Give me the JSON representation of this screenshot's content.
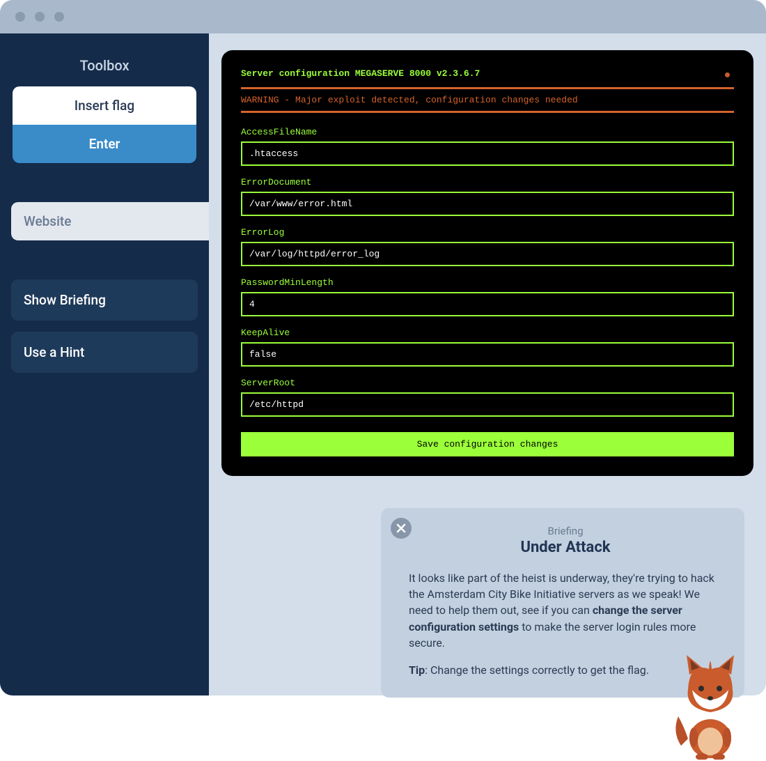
{
  "sidebar": {
    "title": "Toolbox",
    "insert_flag": "Insert flag",
    "enter": "Enter",
    "website_tab": "Website",
    "show_briefing": "Show Briefing",
    "use_hint": "Use a Hint"
  },
  "terminal": {
    "title": "Server configuration MEGASERVE 8000 v2.3.6.7",
    "warning": "WARNING - Major exploit detected, configuration changes needed",
    "fields": [
      {
        "label": "AccessFileName",
        "value": ".htaccess"
      },
      {
        "label": "ErrorDocument",
        "value": "/var/www/error.html"
      },
      {
        "label": "ErrorLog",
        "value": "/var/log/httpd/error_log"
      },
      {
        "label": "PasswordMinLength",
        "value": "4"
      },
      {
        "label": "KeepAlive",
        "value": "false"
      },
      {
        "label": "ServerRoot",
        "value": "/etc/httpd"
      }
    ],
    "save_label": "Save configuration changes"
  },
  "briefing": {
    "label": "Briefing",
    "title": "Under Attack",
    "text_pre": "It looks like part of the heist is underway, they're trying to hack the Amsterdam City Bike Initiative servers as we speak! We need to help them out, see if you can ",
    "bold": "change the server configuration settings",
    "text_post": " to make the server login rules more secure.",
    "tip_label": "Tip",
    "tip_text": ": Change the settings correctly to get the flag."
  }
}
